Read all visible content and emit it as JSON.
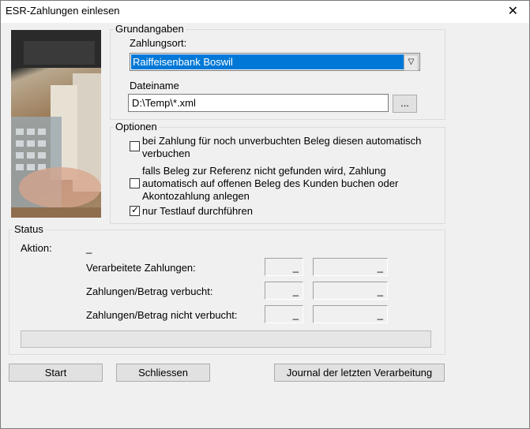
{
  "window": {
    "title": "ESR-Zahlungen einlesen",
    "close_glyph": "✕"
  },
  "grundangaben": {
    "label": "Grundangaben",
    "zahlungsort_label": "Zahlungsort:",
    "zahlungsort_value": "Raiffeisenbank Boswil",
    "dateiname_label": "Dateiname",
    "dateiname_value": "D:\\Temp\\*.xml",
    "browse_label": "..."
  },
  "optionen": {
    "label": "Optionen",
    "option1": {
      "line1": "bei Zahlung für noch unverbuchten Beleg diesen automatisch",
      "line2": "verbuchen",
      "checked": false
    },
    "option2": {
      "line1": "falls Beleg zur Referenz nicht gefunden wird, Zahlung",
      "line2": "automatisch auf offenen Beleg des Kunden buchen oder",
      "line3": "Akontozahlung anlegen",
      "checked": false
    },
    "option3": {
      "line1": "nur Testlauf durchführen",
      "checked": true
    }
  },
  "status": {
    "label": "Status",
    "aktion_label": "Aktion:",
    "aktion_value": "_",
    "rows": [
      {
        "label": "Verarbeitete Zahlungen:",
        "count": "_",
        "amount": "_"
      },
      {
        "label": "Zahlungen/Betrag verbucht:",
        "count": "_",
        "amount": "_"
      },
      {
        "label": "Zahlungen/Betrag nicht verbucht:",
        "count": "_",
        "amount": "_"
      }
    ]
  },
  "buttons": {
    "start": "Start",
    "close": "Schliessen",
    "journal": "Journal der letzten Verarbeitung"
  }
}
